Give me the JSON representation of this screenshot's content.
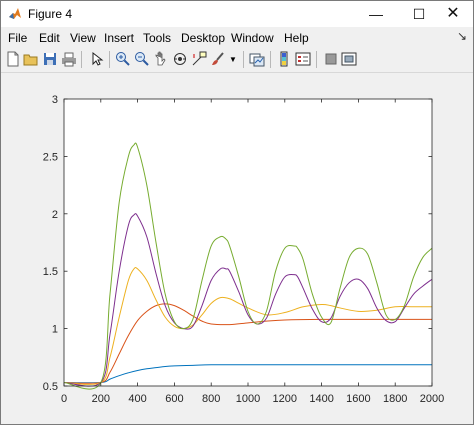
{
  "window": {
    "title": "Figure 4"
  },
  "menu": [
    "File",
    "Edit",
    "View",
    "Insert",
    "Tools",
    "Desktop",
    "Window",
    "Help"
  ],
  "toolbar": [
    "new-figure-icon",
    "open-file-icon",
    "save-icon",
    "print-icon",
    "pointer-icon",
    "zoom-in-icon",
    "zoom-out-icon",
    "pan-icon",
    "rotate-3d-icon",
    "data-cursor-icon",
    "brush-icon",
    "brush-dropdown-icon",
    "link-plot-icon",
    "colorbar-icon",
    "legend-icon",
    "hide-plot-tools-icon",
    "show-plot-tools-icon"
  ],
  "chart_data": {
    "type": "line",
    "xlim": [
      0,
      2000
    ],
    "ylim": [
      0.5,
      3
    ],
    "xticks": [
      "0",
      "200",
      "400",
      "600",
      "800",
      "1000",
      "1200",
      "1400",
      "1600",
      "1800",
      "2000"
    ],
    "yticks": [
      "0.5",
      "1",
      "1.5",
      "2",
      "2.5",
      "3"
    ],
    "grid": false,
    "colors": {
      "blue": "#0072bd",
      "orange": "#d95319",
      "yellow": "#edb120",
      "purple": "#7e2f8e",
      "green": "#77ac30"
    },
    "series": [
      {
        "color": "#0072bd",
        "x": [
          0,
          200,
          250,
          300,
          350,
          400,
          450,
          500,
          550,
          600,
          700,
          800,
          1000,
          2000
        ],
        "y": [
          0.53,
          0.53,
          0.56,
          0.59,
          0.615,
          0.635,
          0.65,
          0.66,
          0.67,
          0.675,
          0.68,
          0.685,
          0.685,
          0.685
        ]
      },
      {
        "color": "#d95319",
        "x": [
          0,
          200,
          250,
          300,
          350,
          400,
          450,
          500,
          550,
          600,
          650,
          700,
          750,
          800,
          900,
          1000,
          1100,
          1200,
          1400,
          1600,
          1800,
          2000
        ],
        "y": [
          0.53,
          0.53,
          0.62,
          0.78,
          0.94,
          1.07,
          1.15,
          1.2,
          1.215,
          1.2,
          1.16,
          1.11,
          1.065,
          1.04,
          1.035,
          1.05,
          1.065,
          1.075,
          1.08,
          1.08,
          1.08,
          1.08
        ]
      },
      {
        "color": "#edb120",
        "x": [
          0,
          200,
          250,
          300,
          350,
          380,
          400,
          450,
          500,
          550,
          600,
          650,
          700,
          750,
          800,
          850,
          900,
          950,
          1000,
          1100,
          1200,
          1300,
          1400,
          1450,
          1500,
          1600,
          1700,
          1800,
          1900,
          2000
        ],
        "y": [
          0.53,
          0.53,
          0.75,
          1.1,
          1.42,
          1.52,
          1.52,
          1.42,
          1.25,
          1.1,
          1.02,
          1.0,
          1.03,
          1.12,
          1.22,
          1.27,
          1.26,
          1.22,
          1.18,
          1.12,
          1.14,
          1.19,
          1.21,
          1.2,
          1.18,
          1.15,
          1.16,
          1.19,
          1.19,
          1.19
        ]
      },
      {
        "color": "#7e2f8e",
        "x": [
          0,
          200,
          250,
          300,
          350,
          380,
          400,
          450,
          500,
          550,
          600,
          650,
          700,
          750,
          800,
          850,
          880,
          900,
          950,
          1000,
          1050,
          1100,
          1150,
          1200,
          1250,
          1270,
          1300,
          1350,
          1400,
          1450,
          1500,
          1550,
          1600,
          1650,
          1700,
          1750,
          1800,
          1850,
          1900,
          1950,
          2000
        ],
        "y": [
          0.53,
          0.53,
          0.95,
          1.5,
          1.9,
          1.99,
          1.98,
          1.8,
          1.48,
          1.2,
          1.05,
          1.0,
          1.02,
          1.2,
          1.42,
          1.52,
          1.52,
          1.5,
          1.32,
          1.12,
          1.04,
          1.09,
          1.3,
          1.45,
          1.47,
          1.45,
          1.35,
          1.17,
          1.06,
          1.09,
          1.28,
          1.4,
          1.43,
          1.35,
          1.18,
          1.07,
          1.06,
          1.18,
          1.3,
          1.37,
          1.43
        ]
      },
      {
        "color": "#77ac30",
        "x": [
          0,
          200,
          250,
          300,
          350,
          380,
          400,
          450,
          500,
          550,
          600,
          650,
          700,
          750,
          800,
          850,
          880,
          900,
          950,
          1000,
          1050,
          1100,
          1150,
          1200,
          1250,
          1270,
          1300,
          1350,
          1400,
          1450,
          1500,
          1550,
          1600,
          1650,
          1700,
          1750,
          1800,
          1850,
          1900,
          1950,
          2000
        ],
        "y": [
          0.53,
          0.53,
          1.3,
          2.1,
          2.5,
          2.6,
          2.58,
          2.25,
          1.75,
          1.3,
          1.06,
          1.0,
          1.08,
          1.42,
          1.72,
          1.8,
          1.78,
          1.72,
          1.45,
          1.15,
          1.04,
          1.15,
          1.5,
          1.7,
          1.72,
          1.7,
          1.6,
          1.3,
          1.1,
          1.05,
          1.35,
          1.62,
          1.7,
          1.65,
          1.4,
          1.12,
          1.08,
          1.2,
          1.45,
          1.62,
          1.7
        ]
      }
    ]
  }
}
